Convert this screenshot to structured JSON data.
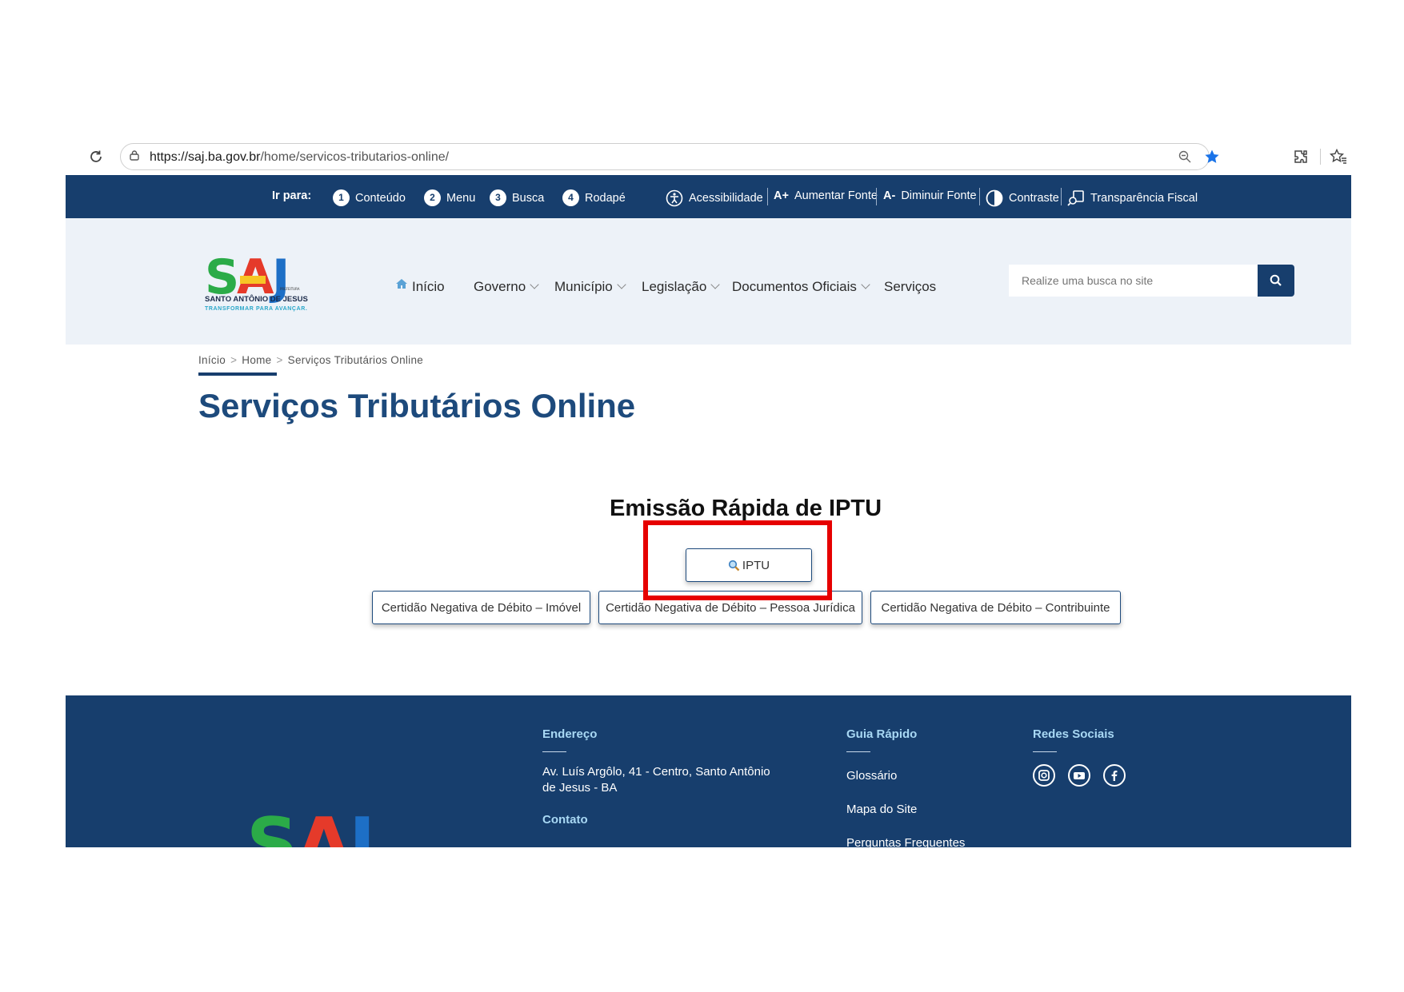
{
  "browser": {
    "url_host": "https://saj.ba.gov.br",
    "url_path": "/home/servicos-tributarios-online/"
  },
  "accessibility_bar": {
    "goto_label": "Ir para:",
    "shortcuts": [
      {
        "number": "1",
        "label": "Conteúdo"
      },
      {
        "number": "2",
        "label": "Menu"
      },
      {
        "number": "3",
        "label": "Busca"
      },
      {
        "number": "4",
        "label": "Rodapé"
      }
    ],
    "tools": [
      {
        "label": "Acessibilidade",
        "icon": "accessibility-icon"
      },
      {
        "label": "Aumentar Fonte",
        "prefix": "A+"
      },
      {
        "label": "Diminuir Fonte",
        "prefix": "A-"
      },
      {
        "label": "Contraste",
        "icon": "contrast-icon"
      },
      {
        "label": "Transparência Fiscal",
        "icon": "transparency-icon"
      }
    ]
  },
  "header": {
    "logo": {
      "text": "SAJ",
      "subtitle": "SANTO ANTÔNIO DE JESUS",
      "tagline": "TRANSFORMAR PARA AVANÇAR.",
      "small": "PREFEITURA"
    },
    "nav": [
      {
        "label": "Início",
        "dropdown": false
      },
      {
        "label": "Governo",
        "dropdown": true
      },
      {
        "label": "Município",
        "dropdown": true
      },
      {
        "label": "Legislação",
        "dropdown": true
      },
      {
        "label": "Documentos Oficiais",
        "dropdown": true
      },
      {
        "label": "Serviços",
        "dropdown": false
      }
    ],
    "search_placeholder": "Realize uma busca no site"
  },
  "breadcrumb": [
    "Início",
    "Home",
    "Serviços Tributários Online"
  ],
  "page_title": "Serviços Tributários Online",
  "main": {
    "section_title": "Emissão Rápida de IPTU",
    "iptu_button": "IPTU",
    "cnd_buttons": [
      "Certidão Negativa de Débito – Imóvel",
      "Certidão Negativa de Débito – Pessoa Jurídica",
      "Certidão Negativa de Débito – Contribuinte"
    ]
  },
  "footer": {
    "endereco_title": "Endereço",
    "address_line1": "Av. Luís Argôlo, 41 - Centro, Santo Antônio",
    "address_line2": "de Jesus - BA",
    "contato_title": "Contato",
    "guia_title": "Guia Rápido",
    "guia_items": [
      "Glossário",
      "Mapa do Site",
      "Perguntas Frequentes"
    ],
    "redes_title": "Redes Sociais",
    "social_icons": [
      "instagram-icon",
      "youtube-icon",
      "facebook-icon"
    ]
  },
  "colors": {
    "brand_navy": "#173e6d",
    "title_blue": "#1d4a7c",
    "highlight_red": "#e60000"
  }
}
